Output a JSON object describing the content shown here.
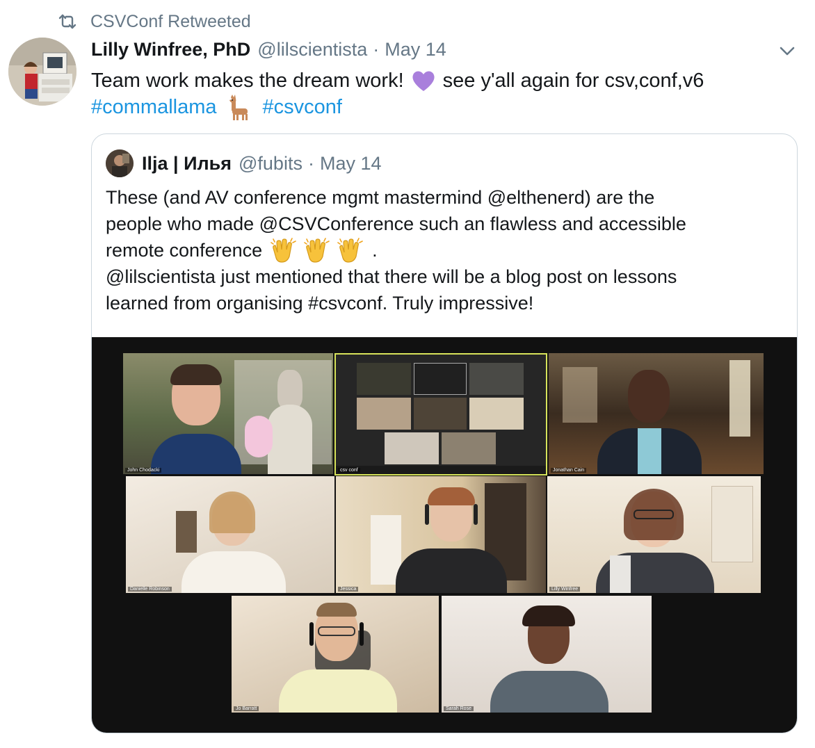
{
  "retweet": {
    "text": "CSVConf Retweeted",
    "icon": "retweet-icon"
  },
  "tweet": {
    "author_name": "Lilly Winfree, PhD",
    "handle": "@lilscientista",
    "separator": "·",
    "date": "May 14",
    "text_part1": "Team work makes the dream work!",
    "text_part2": "see y'all again for csv,conf,v6",
    "hashtag1": "#commallama",
    "hashtag2": "#csvconf",
    "emoji_heart": "purple-heart-icon",
    "emoji_llama": "llama-icon"
  },
  "quote": {
    "author_name": "Ilja | Илья",
    "handle": "@fubits",
    "separator": "·",
    "date": "May 14",
    "line1": "These (and AV conference mgmt mastermind @elthenerd) are the",
    "line2": "people who made @CSVConference such an flawless and accessible",
    "line3": "remote conference",
    "line3_end": ".",
    "line4": "@lilscientista just mentioned that there will be a blog post on lessons",
    "line5": "learned from organising #csvconf. Truly impressive!",
    "emoji_clap": "clapping-hands-icon"
  },
  "video_call": {
    "tiles": [
      {
        "label": "John Chodacki"
      },
      {
        "label": "csv conf"
      },
      {
        "label": "Jonathan Cain"
      },
      {
        "label": "Danielle Robinson"
      },
      {
        "label": "Jessica"
      },
      {
        "label": "Lilly Winfree"
      },
      {
        "label": "Jo Barratt"
      },
      {
        "label": "Sarah Rose"
      }
    ]
  },
  "colors": {
    "text": "#14171a",
    "secondary": "#657786",
    "link": "#1b95e0",
    "border": "#ccd6dd",
    "heart": "#a97fdc"
  }
}
